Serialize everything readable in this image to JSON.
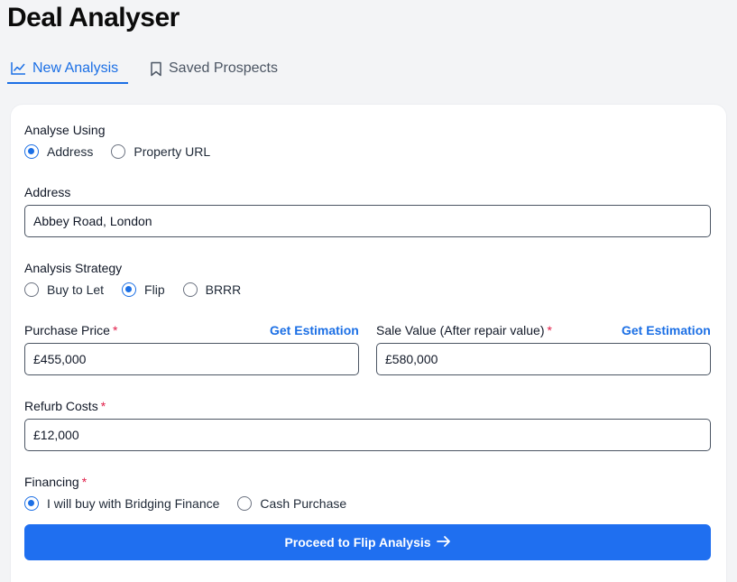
{
  "title": "Deal Analyser",
  "tabs": {
    "new_analysis": {
      "label": "New Analysis",
      "icon": "line-chart-icon"
    },
    "saved_prospects": {
      "label": "Saved Prospects",
      "icon": "bookmark-icon"
    }
  },
  "form": {
    "analyse_using": {
      "label": "Analyse Using",
      "options": [
        "Address",
        "Property URL"
      ],
      "selected": "Address"
    },
    "address": {
      "label": "Address",
      "value": "Abbey Road, London"
    },
    "strategy": {
      "label": "Analysis Strategy",
      "options": [
        "Buy to Let",
        "Flip",
        "BRRR"
      ],
      "selected": "Flip"
    },
    "purchase_price": {
      "label": "Purchase Price",
      "required": "*",
      "value": "£455,000",
      "action": "Get Estimation"
    },
    "sale_value": {
      "label": "Sale Value (After repair value)",
      "required": "*",
      "value": "£580,000",
      "action": "Get Estimation"
    },
    "refurb_costs": {
      "label": "Refurb Costs",
      "required": "*",
      "value": "£12,000"
    },
    "financing": {
      "label": "Financing",
      "required": "*",
      "options": [
        "I will buy with Bridging Finance",
        "Cash Purchase"
      ],
      "selected": "I will buy with Bridging Finance"
    },
    "submit": {
      "label": "Proceed to Flip Analysis",
      "icon": "arrow-right-icon"
    }
  },
  "colors": {
    "accent": "#1b6fe5",
    "button": "#1f6ff0",
    "required": "#e11d48"
  }
}
